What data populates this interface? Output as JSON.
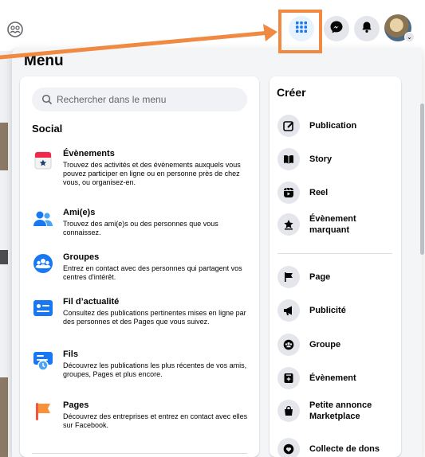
{
  "menu": {
    "title": "Menu"
  },
  "search": {
    "placeholder": "Rechercher dans le menu"
  },
  "social": {
    "title": "Social",
    "items": [
      {
        "name": "Évènements",
        "desc": "Trouvez des activités et des évènements auxquels vous pouvez participer en ligne ou en personne près de chez vous, ou organisez-en."
      },
      {
        "name": "Ami(e)s",
        "desc": "Trouvez des ami(e)s ou des personnes que vous connaissez."
      },
      {
        "name": "Groupes",
        "desc": "Entrez en contact avec des personnes qui partagent vos centres d'intérêt."
      },
      {
        "name": "Fil d’actualité",
        "desc": "Consultez des publications pertinentes mises en ligne par des personnes et des Pages que vous suivez."
      },
      {
        "name": "Fils",
        "desc": "Découvrez les publications les plus récentes de vos amis, groupes, Pages et plus encore."
      },
      {
        "name": "Pages",
        "desc": "Découvrez des entreprises et entrez en contact avec elles sur Facebook."
      }
    ]
  },
  "create": {
    "title": "Créer",
    "items": [
      {
        "label": "Publication"
      },
      {
        "label": "Story"
      },
      {
        "label": "Reel"
      },
      {
        "label": "Évènement marquant"
      },
      {
        "label": "Page"
      },
      {
        "label": "Publicité"
      },
      {
        "label": "Groupe"
      },
      {
        "label": "Évènement"
      },
      {
        "label": "Petite annonce Marketplace"
      },
      {
        "label": "Collecte de dons"
      }
    ]
  },
  "colors": {
    "accent": "#1877f2",
    "highlight": "#f08a43",
    "panel": "#f4f5f7"
  },
  "icons": {
    "top": [
      "groups-icon",
      "menu-grid-icon",
      "messenger-icon",
      "bell-icon",
      "avatar"
    ],
    "social": [
      "calendar-icon",
      "friends-icon",
      "groups-icon",
      "feed-icon",
      "feeds-icon",
      "pages-flag-icon"
    ],
    "create": [
      "edit-icon",
      "book-icon",
      "reel-icon",
      "star-icon",
      "flag-icon",
      "megaphone-icon",
      "groups-icon",
      "calendar-plus-icon",
      "bag-icon",
      "heart-icon"
    ]
  }
}
